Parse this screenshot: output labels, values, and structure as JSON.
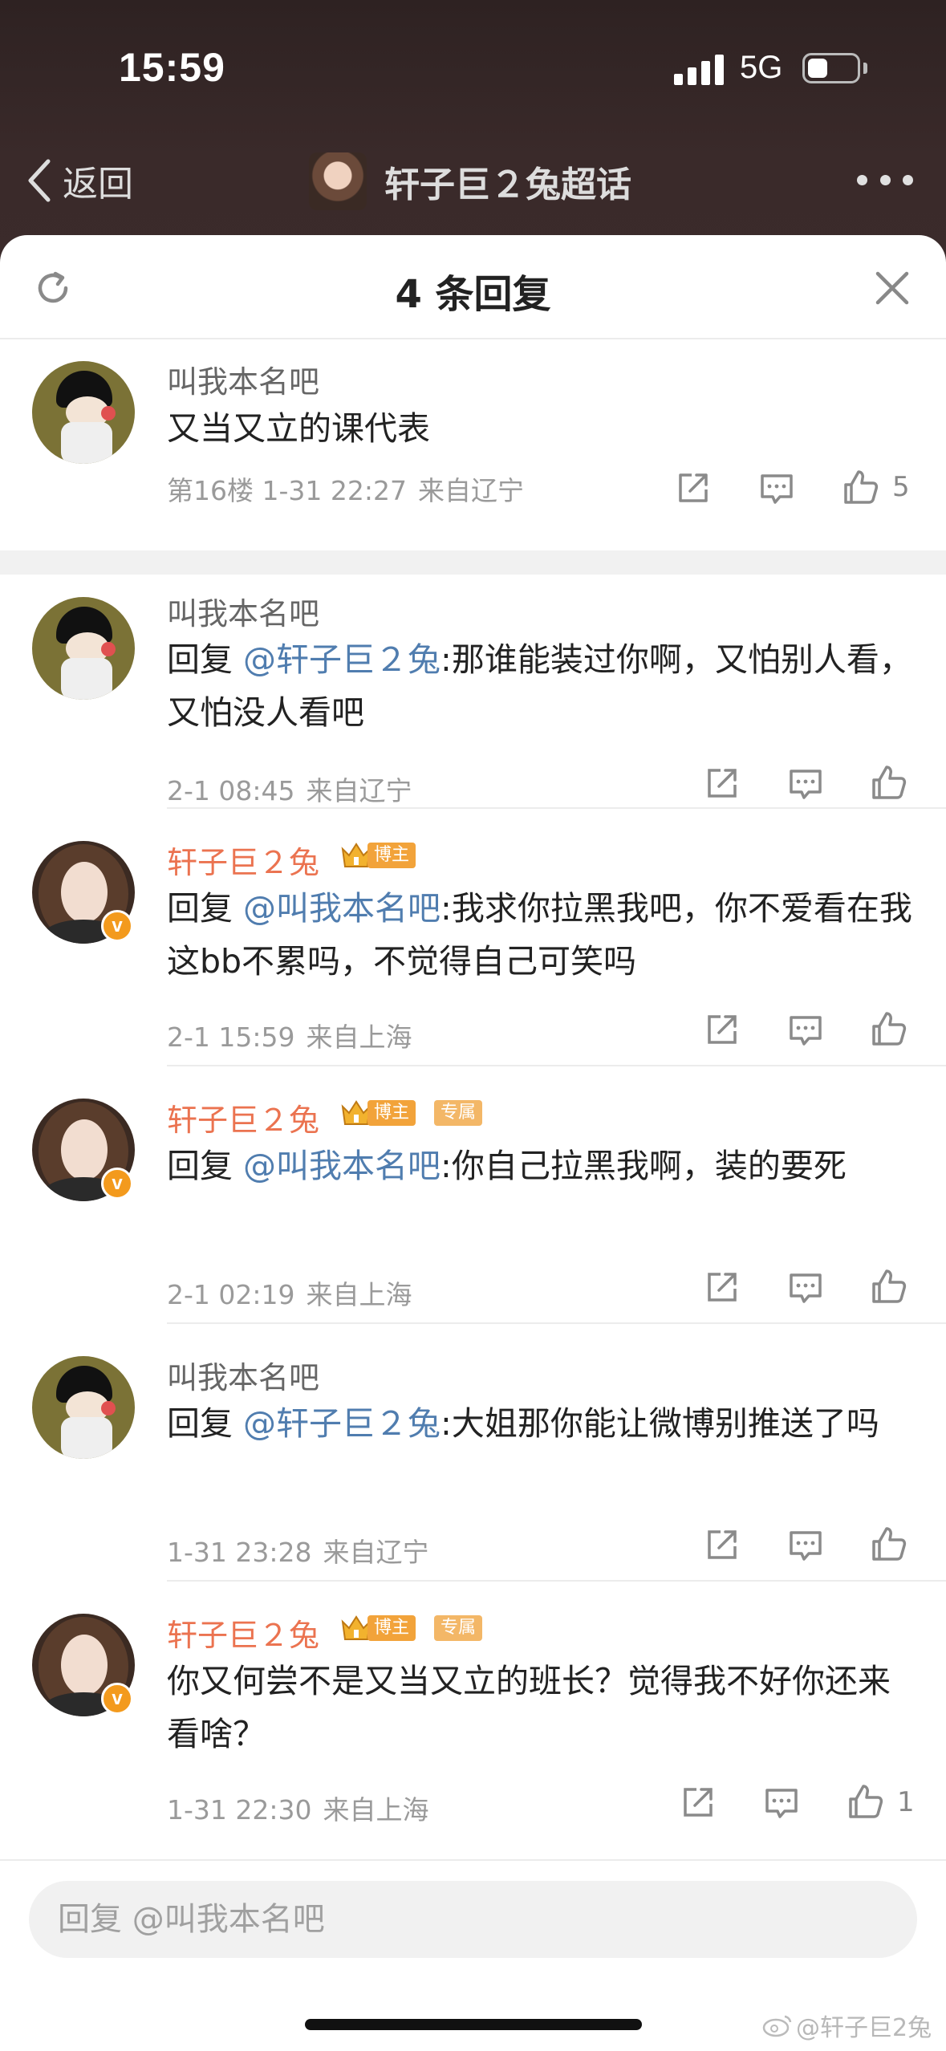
{
  "status_bar": {
    "time": "15:59",
    "network": "5G"
  },
  "nav": {
    "back_label": "返回",
    "title": "轩子巨２兔超话"
  },
  "sheet": {
    "title": "4 条回复"
  },
  "root": {
    "name": "叫我本名吧",
    "text": "又当又立的课代表",
    "meta_time": "第16楼 1-31 22:27",
    "meta_source": "来自辽宁",
    "like_count": "5"
  },
  "replies": [
    {
      "name": "叫我本名吧",
      "prefix": "回复 ",
      "mention": "@轩子巨２兔",
      "text": ":那谁能装过你啊，又怕别人看， 又怕没人看吧",
      "meta_time": "2-1 08:45",
      "meta_source": "来自辽宁"
    },
    {
      "name": "轩子巨２兔",
      "badge": "博主",
      "prefix": "回复 ",
      "mention": "@叫我本名吧",
      "text": ":我求你拉黑我吧，你不爱看在我这bb不累吗，不觉得自己可笑吗",
      "meta_time": "2-1 15:59",
      "meta_source": "来自上海",
      "vbadge": "v"
    },
    {
      "name": "轩子巨２兔",
      "badge": "博主",
      "badge2": "专属",
      "prefix": "回复 ",
      "mention": "@叫我本名吧",
      "text": ":你自己拉黑我啊，装的要死",
      "meta_time": "2-1 02:19",
      "meta_source": "来自上海",
      "vbadge": "v"
    },
    {
      "name": "叫我本名吧",
      "prefix": "回复 ",
      "mention": "@轩子巨２兔",
      "text": ":大姐那你能让微博别推送了吗",
      "meta_time": "1-31 23:28",
      "meta_source": "来自辽宁"
    },
    {
      "name": "轩子巨２兔",
      "badge": "博主",
      "badge2": "专属",
      "text": "你又何尝不是又当又立的班长？觉得我不好你还来看啥？",
      "meta_time": "1-31 22:30",
      "meta_source": "来自上海",
      "like_count": "1",
      "vbadge": "v"
    }
  ],
  "reply_box": {
    "placeholder": "回复 @叫我本名吧"
  },
  "watermark": "@轩子巨2兔",
  "colors": {
    "owner_name": "#eb7350",
    "mention": "#507daf",
    "boss_badge": "#f2a33a",
    "verified": "#f39a1d"
  }
}
